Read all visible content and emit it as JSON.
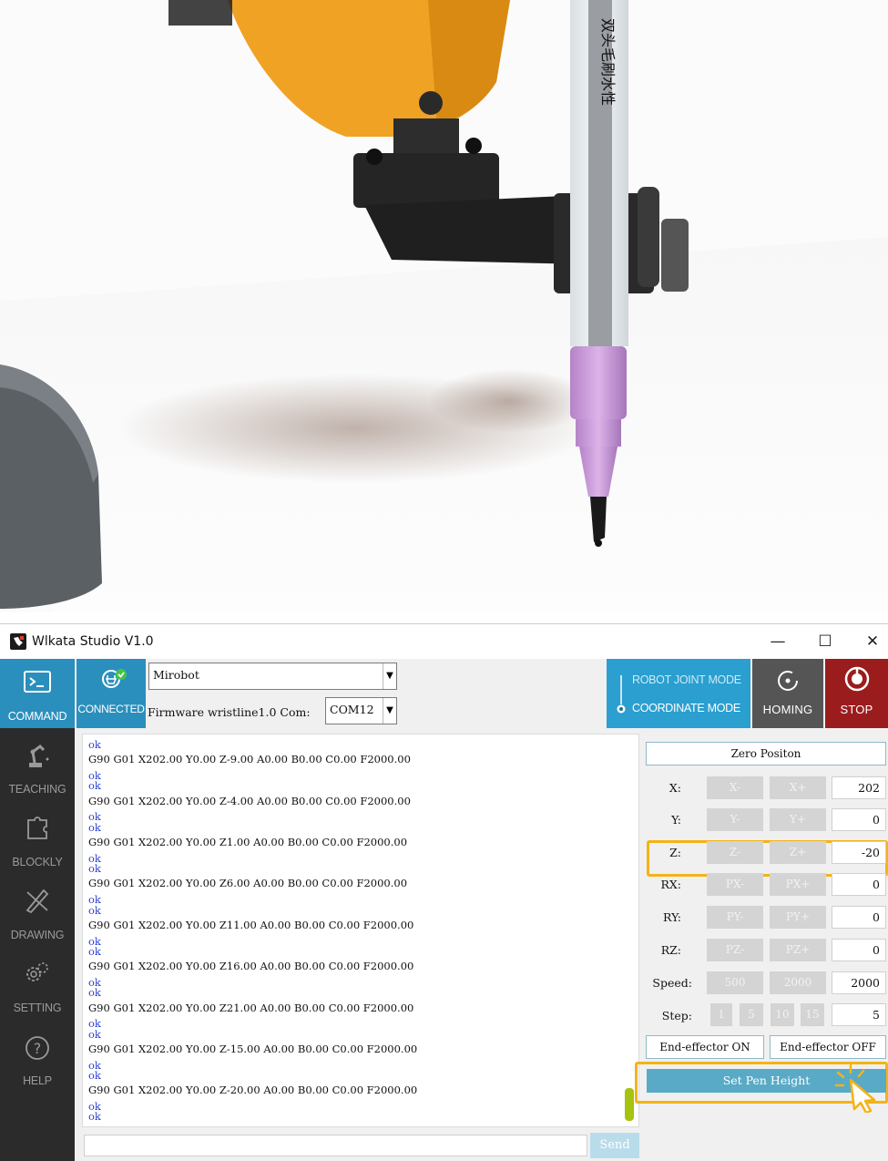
{
  "window": {
    "title": "Wlkata Studio V1.0",
    "minimize": "—",
    "maximize": "☐",
    "close": "✕"
  },
  "photo": {
    "pen_text": "双头毛刷水性"
  },
  "nav": [
    {
      "label": "COMMAND",
      "icon": "terminal-icon",
      "active": true
    },
    {
      "label": "TEACHING",
      "icon": "robot-arm-icon",
      "active": false
    },
    {
      "label": "BLOCKLY",
      "icon": "puzzle-icon",
      "active": false
    },
    {
      "label": "DRAWING",
      "icon": "pen-ruler-icon",
      "active": false
    },
    {
      "label": "SETTING",
      "icon": "gears-icon",
      "active": false
    },
    {
      "label": "HELP",
      "icon": "question-icon",
      "active": false
    }
  ],
  "toolbar": {
    "connected_label": "CONNECTED",
    "device_select": "Mirobot",
    "firmware_label": "Firmware wristline1.0 Com:",
    "com_select": "COM12",
    "mode_joint": "ROBOT JOINT MODE",
    "mode_coordinate": "COORDINATE MODE",
    "homing_label": "HOMING",
    "stop_label": "STOP"
  },
  "console": {
    "lines": [
      {
        "type": "ok",
        "text": "ok"
      },
      {
        "type": "cmd",
        "text": "G90 G01 X202.00 Y0.00 Z-9.00 A0.00 B0.00 C0.00 F2000.00"
      },
      {
        "type": "ok",
        "text": "ok"
      },
      {
        "type": "ok",
        "text": "ok"
      },
      {
        "type": "cmd",
        "text": "G90 G01 X202.00 Y0.00 Z-4.00 A0.00 B0.00 C0.00 F2000.00"
      },
      {
        "type": "ok",
        "text": "ok"
      },
      {
        "type": "ok",
        "text": "ok"
      },
      {
        "type": "cmd",
        "text": "G90 G01 X202.00 Y0.00 Z1.00 A0.00 B0.00 C0.00 F2000.00"
      },
      {
        "type": "ok",
        "text": "ok"
      },
      {
        "type": "ok",
        "text": "ok"
      },
      {
        "type": "cmd",
        "text": "G90 G01 X202.00 Y0.00 Z6.00 A0.00 B0.00 C0.00 F2000.00"
      },
      {
        "type": "ok",
        "text": "ok"
      },
      {
        "type": "ok",
        "text": "ok"
      },
      {
        "type": "cmd",
        "text": "G90 G01 X202.00 Y0.00 Z11.00 A0.00 B0.00 C0.00 F2000.00"
      },
      {
        "type": "ok",
        "text": "ok"
      },
      {
        "type": "ok",
        "text": "ok"
      },
      {
        "type": "cmd",
        "text": "G90 G01 X202.00 Y0.00 Z16.00 A0.00 B0.00 C0.00 F2000.00"
      },
      {
        "type": "ok",
        "text": "ok"
      },
      {
        "type": "ok",
        "text": "ok"
      },
      {
        "type": "cmd",
        "text": "G90 G01 X202.00 Y0.00 Z21.00 A0.00 B0.00 C0.00 F2000.00"
      },
      {
        "type": "ok",
        "text": "ok"
      },
      {
        "type": "ok",
        "text": "ok"
      },
      {
        "type": "cmd",
        "text": "G90 G01 X202.00 Y0.00 Z-15.00 A0.00 B0.00 C0.00 F2000.00"
      },
      {
        "type": "ok",
        "text": "ok"
      },
      {
        "type": "ok",
        "text": "ok"
      },
      {
        "type": "cmd",
        "text": "G90 G01 X202.00 Y0.00 Z-20.00 A0.00 B0.00 C0.00 F2000.00"
      },
      {
        "type": "ok",
        "text": "ok"
      },
      {
        "type": "ok",
        "text": "ok"
      }
    ],
    "send_value": "",
    "send_label": "Send"
  },
  "panel": {
    "zero_position": "Zero Positon",
    "axes": [
      {
        "label": "X:",
        "minus": "X-",
        "plus": "X+",
        "value": "202"
      },
      {
        "label": "Y:",
        "minus": "Y-",
        "plus": "Y+",
        "value": "0"
      },
      {
        "label": "Z:",
        "minus": "Z-",
        "plus": "Z+",
        "value": "-20"
      },
      {
        "label": "RX:",
        "minus": "PX-",
        "plus": "PX+",
        "value": "0"
      },
      {
        "label": "RY:",
        "minus": "PY-",
        "plus": "PY+",
        "value": "0"
      },
      {
        "label": "RZ:",
        "minus": "PZ-",
        "plus": "PZ+",
        "value": "0"
      }
    ],
    "speed_label": "Speed:",
    "speed_options": [
      "500",
      "2000"
    ],
    "speed_value": "2000",
    "step_label": "Step:",
    "step_options": [
      "1",
      "5",
      "10",
      "15"
    ],
    "step_value": "5",
    "effector_on": "End-effector ON",
    "effector_off": "End-effector OFF",
    "set_pen_height": "Set Pen Height"
  },
  "colors": {
    "accent": "#2a8fbd",
    "highlight": "#f4b316",
    "stop": "#9b1c1c",
    "ok_text": "#2a3fcf"
  }
}
